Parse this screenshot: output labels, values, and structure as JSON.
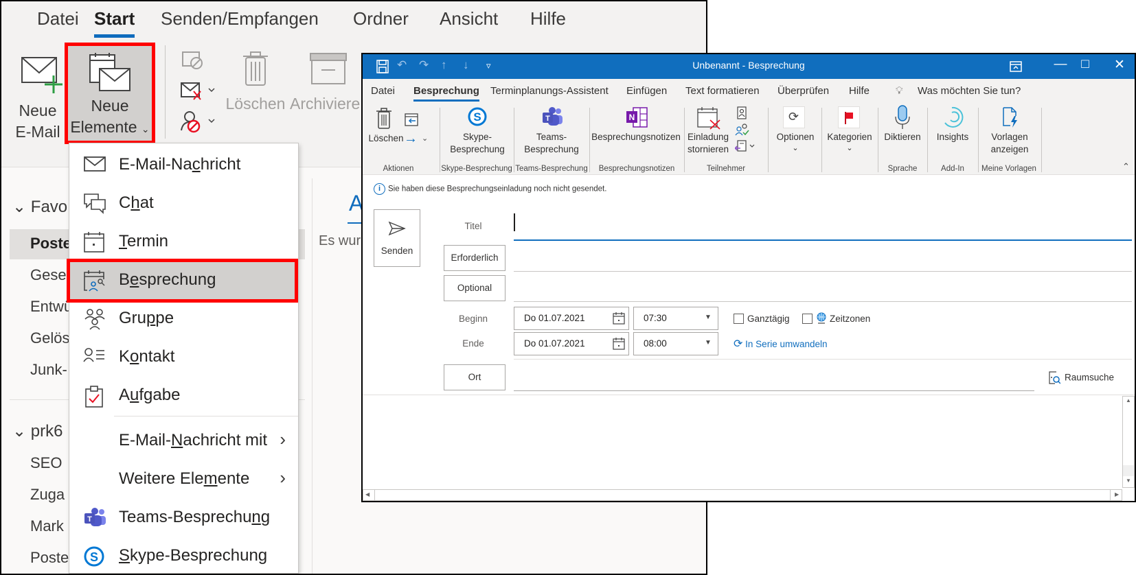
{
  "outlook": {
    "tabs": [
      "Datei",
      "Start",
      "Senden/Empfangen",
      "Ordner",
      "Ansicht",
      "Hilfe"
    ],
    "active_tab": "Start",
    "ribbon": {
      "neue_email": {
        "line1": "Neue",
        "line2": "E-Mail"
      },
      "neue_elemente": {
        "line1": "Neue",
        "line2": "Elemente"
      },
      "loeschen": "Löschen",
      "archivieren": "Archiviere"
    },
    "nav": {
      "favorites_header": "Favo",
      "favorites": [
        "Poste",
        "Gesen",
        "Entwü",
        "Gelös",
        "Junk-"
      ],
      "account_header": "prk6",
      "account_folders": [
        "SEO",
        "Zuga",
        "Mark",
        "Poste"
      ]
    },
    "reading_pane": {
      "tab_letter": "A",
      "text": "Es wurd"
    }
  },
  "menu": {
    "items": [
      {
        "icon": "mail-icon",
        "pre": "E-Mail-Na",
        "acc": "c",
        "post": "hricht",
        "selected": false
      },
      {
        "icon": "chat-icon",
        "pre": "C",
        "acc": "h",
        "post": "at",
        "selected": false
      },
      {
        "icon": "calendar-icon",
        "pre": "",
        "acc": "T",
        "post": "ermin",
        "selected": false
      },
      {
        "icon": "meeting-icon",
        "pre": "B",
        "acc": "e",
        "post": "sprechung",
        "selected": true
      },
      {
        "icon": "group-icon",
        "pre": "Gru",
        "acc": "p",
        "post": "pe",
        "selected": false
      },
      {
        "icon": "contact-icon",
        "pre": "K",
        "acc": "o",
        "post": "ntakt",
        "selected": false
      },
      {
        "icon": "task-icon",
        "pre": "A",
        "acc": "u",
        "post": "fgabe",
        "selected": false
      },
      {
        "icon": "",
        "pre": "E-Mail-",
        "acc": "N",
        "post": "achricht mit",
        "submenu": true
      },
      {
        "icon": "",
        "pre": "Weitere Ele",
        "acc": "m",
        "post": "ente",
        "submenu": true
      },
      {
        "icon": "teams-icon",
        "pre": "Teams-Besprechu",
        "acc": "n",
        "post": "g"
      },
      {
        "icon": "skype-icon",
        "pre": "",
        "acc": "S",
        "post": "kype-Besprechung"
      }
    ]
  },
  "dialog": {
    "title": "Unbenannt  -  Besprechung",
    "tabs": [
      "Datei",
      "Besprechung",
      "Terminplanungs-Assistent",
      "Einfügen",
      "Text formatieren",
      "Überprüfen",
      "Hilfe"
    ],
    "active_tab": "Besprechung",
    "tell_me": "Was möchten Sie tun?",
    "ribbon": {
      "loeschen": "Löschen",
      "skype_btn": [
        "Skype-",
        "Besprechung"
      ],
      "teams_btn": [
        "Teams-",
        "Besprechung"
      ],
      "notes_btn": "Besprechungsnotizen",
      "cancel_btn": [
        "Einladung",
        "stornieren"
      ],
      "options_btn": "Optionen",
      "categories_btn": "Kategorien",
      "dictate_btn": "Diktieren",
      "insights_btn": "Insights",
      "templates_btn": [
        "Vorlagen",
        "anzeigen"
      ],
      "groups": [
        "Aktionen",
        "Skype-Besprechung",
        "Teams-Besprechung",
        "Besprechungsnotizen",
        "Teilnehmer",
        "Sprache",
        "Add-In",
        "Meine Vorlagen"
      ]
    },
    "info": "Sie haben diese Besprechungseinladung noch nicht gesendet.",
    "form": {
      "send_label": "Senden",
      "title_label": "Titel",
      "title_value": "",
      "required_label": "Erforderlich",
      "optional_label": "Optional",
      "start_label": "Beginn",
      "end_label": "Ende",
      "start_date": "Do 01.07.2021",
      "start_time": "07:30",
      "end_date": "Do 01.07.2021",
      "end_time": "08:00",
      "all_day_label": "Ganztägig",
      "all_day_checked": false,
      "timezones_label": "Zeitzonen",
      "timezones_checked": false,
      "recurrence_link": "In Serie umwandeln",
      "location_label": "Ort",
      "room_search": "Raumsuche"
    }
  }
}
